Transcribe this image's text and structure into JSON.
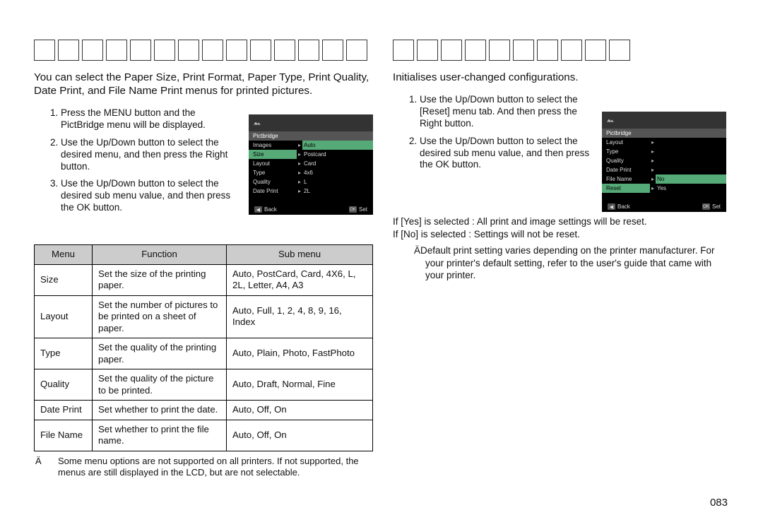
{
  "left": {
    "title_box_count": 14,
    "intro": "You can select the Paper Size, Print Format, Paper Type, Print Quality, Date Print, and File Name Print menus for printed pictures.",
    "steps": [
      "Press the MENU button and the PictBridge menu will be displayed.",
      "Use the Up/Down button to select the desired menu, and then press the Right button.",
      "Use the Up/Down button to select the desired sub menu value, and then press the OK button."
    ],
    "lcd": {
      "header": "Pictbridge",
      "rows": [
        {
          "k": "Images",
          "v": "Auto",
          "hlv": true
        },
        {
          "k": "Size",
          "v": "Postcard",
          "hl": true
        },
        {
          "k": "Layout",
          "v": "Card"
        },
        {
          "k": "Type",
          "v": "4x6"
        },
        {
          "k": "Quality",
          "v": "L"
        },
        {
          "k": "Date Print",
          "v": "2L"
        }
      ],
      "bar_back": "Back",
      "bar_set": "Set",
      "bar_ok": "OK"
    },
    "table": {
      "headers": [
        "Menu",
        "Function",
        "Sub menu"
      ],
      "rows": [
        {
          "menu": "Size",
          "func": "Set the size of the printing paper.",
          "sub": "Auto, PostCard, Card, 4X6, L, 2L, Letter, A4, A3"
        },
        {
          "menu": "Layout",
          "func": "Set the number of pictures to be printed on a sheet of paper.",
          "sub": "Auto, Full, 1, 2, 4, 8, 9, 16, Index"
        },
        {
          "menu": "Type",
          "func": "Set the quality of the printing paper.",
          "sub": "Auto, Plain, Photo, FastPhoto"
        },
        {
          "menu": "Quality",
          "func": "Set the quality of the picture to be printed.",
          "sub": "Auto, Draft, Normal, Fine"
        },
        {
          "menu": "Date Print",
          "func": "Set whether to print the date.",
          "sub": "Auto, Off, On"
        },
        {
          "menu": "File Name",
          "func": "Set whether to print the ﬁle name.",
          "sub": "Auto, Off, On"
        }
      ]
    },
    "footnote": "Some menu options are not supported on all printers. If not supported, the menus are still displayed in the LCD, but are not selectable.",
    "footnote_mark": "Ä"
  },
  "right": {
    "title_box_count": 10,
    "intro": "Initialises user-changed conﬁgurations.",
    "steps": [
      "Use the Up/Down button to select the [Reset] menu tab. And then press the Right button.",
      "Use the Up/Down button to select the desired sub menu value, and then press the OK button."
    ],
    "lcd": {
      "header": "Pictbridge",
      "rows": [
        {
          "k": "Layout",
          "v": ""
        },
        {
          "k": "Type",
          "v": ""
        },
        {
          "k": "Quality",
          "v": ""
        },
        {
          "k": "Date Print",
          "v": ""
        },
        {
          "k": "File Name",
          "v": "No",
          "hlv": true
        },
        {
          "k": "Reset",
          "v": "Yes",
          "hl": true
        }
      ],
      "bar_back": "Back",
      "bar_set": "Set",
      "bar_ok": "OK"
    },
    "line_yes": "If [Yes] is selected :  All print and image settings will be reset.",
    "line_no": "If [No] is selected : Settings will not be reset.",
    "footnote_mark": "Ä",
    "footnote": "Default print setting varies depending on the printer manufacturer. For your printer's default setting, refer to the user's guide that came with your printer."
  },
  "page_number": "083"
}
